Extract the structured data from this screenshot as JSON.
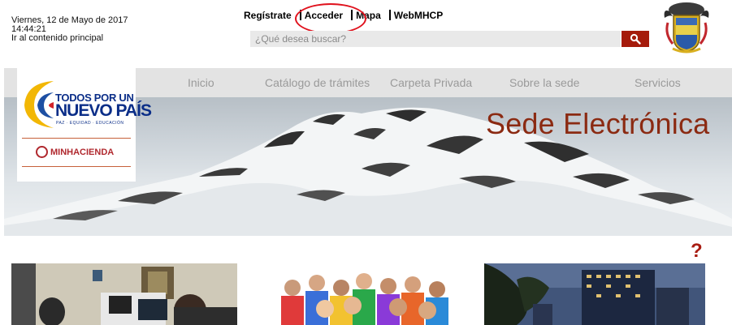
{
  "header": {
    "date": "Viernes, 12 de Mayo de 2017",
    "time": "14:44:21",
    "skip_link": "Ir al contenido principal"
  },
  "top_links": {
    "register": "Regístrate",
    "login": "Acceder",
    "map": "Mapa",
    "webmhcp": "WebMHCP"
  },
  "search": {
    "placeholder": "¿Qué desea buscar?",
    "button_icon": "search-icon"
  },
  "nav": {
    "items": [
      "Inicio",
      "Catálogo de trámites",
      "Carpeta Privada",
      "Sobre la sede",
      "Servicios"
    ]
  },
  "logo": {
    "line1": "TODOS POR UN",
    "line2": "NUEVO PAÍS",
    "line3": "PAZ · EQUIDAD · EDUCACIÓN",
    "ministry": "MINHACIENDA"
  },
  "banner": {
    "title": "Sede Electrónica"
  },
  "help": {
    "label": "?"
  },
  "colors": {
    "brand_red": "#a51b0b",
    "title_red": "#8b2a12",
    "highlight": "#e0121d",
    "nav_bg": "#e3e3e3",
    "nav_text": "#9a9a9a"
  }
}
